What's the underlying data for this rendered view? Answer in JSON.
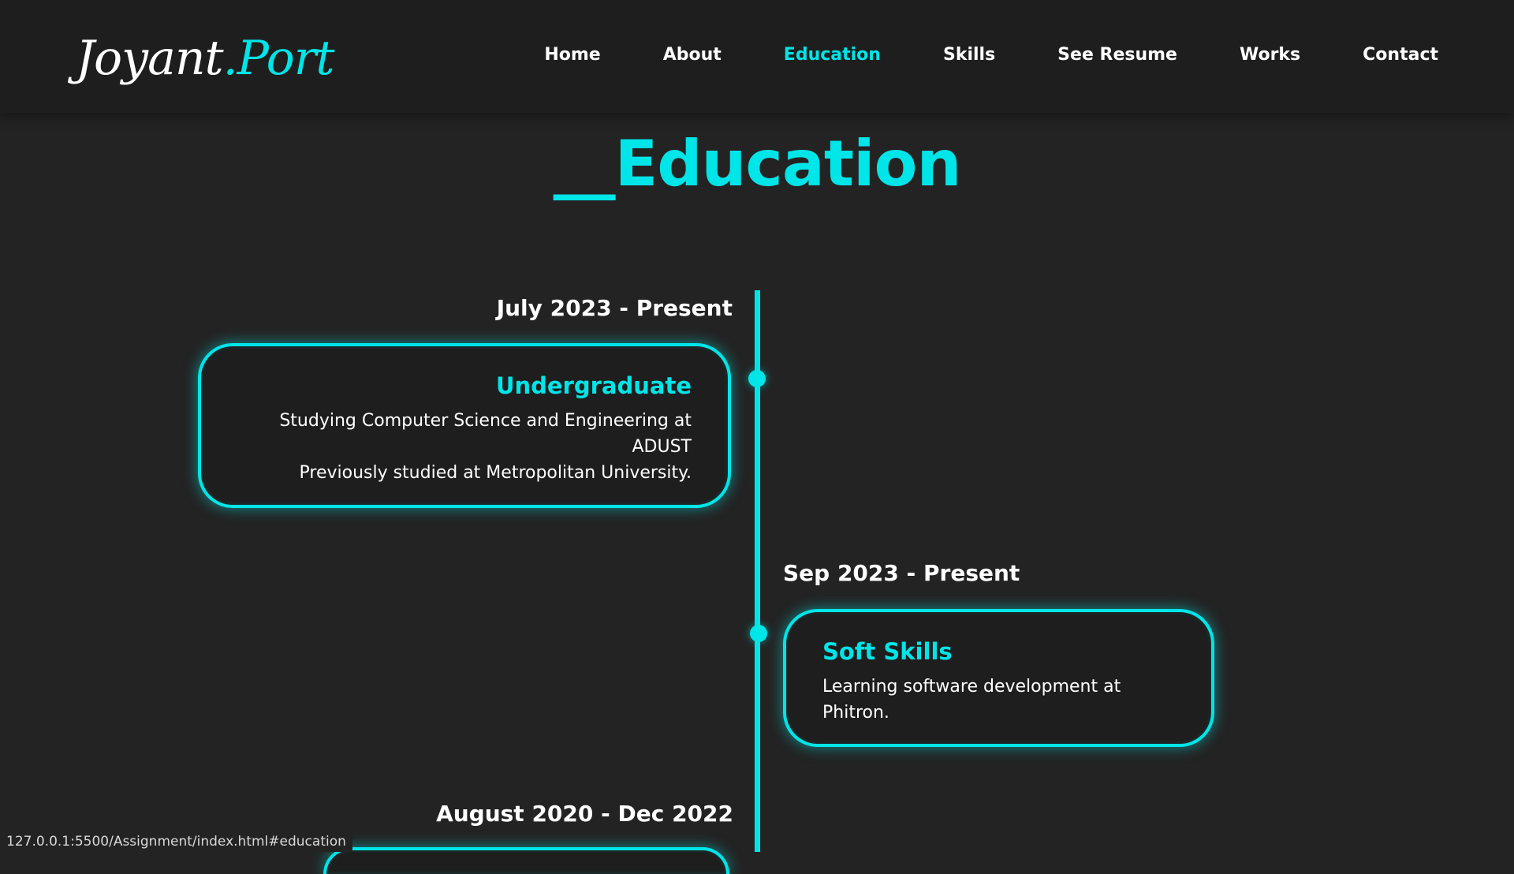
{
  "logo": {
    "part1": "Joyant",
    "part2": ".Port"
  },
  "nav": {
    "items": [
      {
        "label": "Home"
      },
      {
        "label": "About"
      },
      {
        "label": "Education"
      },
      {
        "label": "Skills"
      },
      {
        "label": "See Resume"
      },
      {
        "label": "Works"
      },
      {
        "label": "Contact"
      }
    ],
    "active": "Education"
  },
  "section": {
    "title": "__Education"
  },
  "timeline": [
    {
      "date": "July 2023 - Present",
      "title": "Undergraduate",
      "lines": [
        "Studying Computer Science and Engineering at ADUST",
        "Previously studied at Metropolitan University."
      ],
      "side": "left"
    },
    {
      "date": "Sep 2023 - Present",
      "title": "Soft Skills",
      "lines": [
        "Learning software development at Phitron."
      ],
      "side": "right"
    },
    {
      "date": "August 2020 - Dec 2022",
      "side": "left"
    }
  ],
  "status_bar": {
    "url": "127.0.0.1:5500/Assignment/index.html#education"
  },
  "colors": {
    "accent": "#00e5e8",
    "background": "#232323",
    "nav_background": "#1e1e1e"
  }
}
